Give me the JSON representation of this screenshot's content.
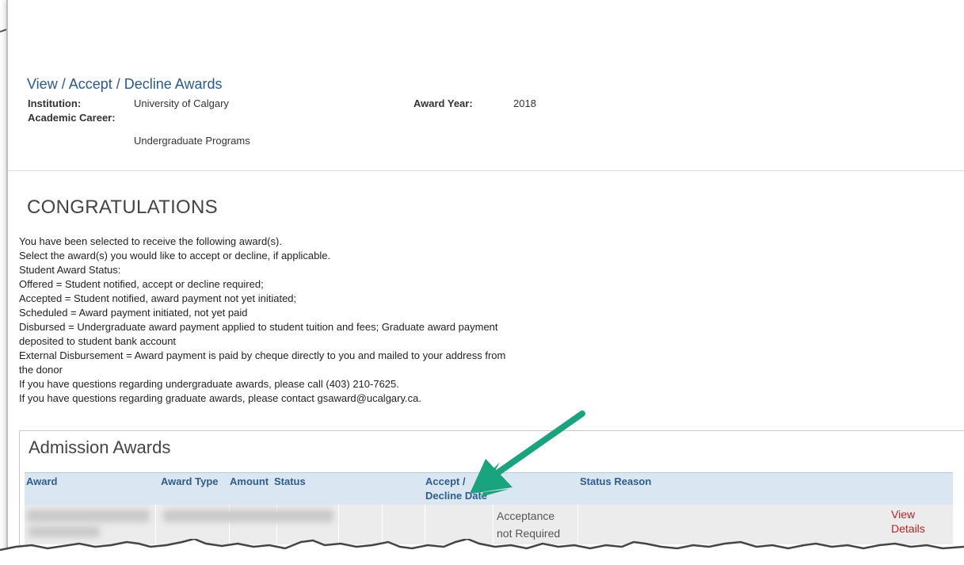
{
  "page": {
    "title": "View / Accept / Decline Awards",
    "institution_label": "Institution:",
    "institution_value": "University of Calgary",
    "award_year_label": "Award Year:",
    "award_year_value": "2018",
    "career_label": "Academic Career:",
    "career_value": "Undergraduate Programs"
  },
  "message": {
    "heading": "CONGRATULATIONS",
    "lines": [
      "You have been selected to receive the following award(s).",
      "Select the award(s) you would like to accept or decline, if applicable.",
      "Student Award Status:",
      "Offered = Student notified, accept or decline required;",
      "Accepted = Student notified, award payment not yet initiated;",
      "Scheduled = Award payment initiated, not yet paid",
      "Disbursed = Undergraduate award payment applied to student tuition and fees; Graduate award payment",
      "deposited to student bank account",
      "External Disbursement = Award payment is paid by cheque directly to you and mailed to your address from",
      "the donor",
      "If you have questions regarding undergraduate awards, please call (403) 210-7625.",
      "If you have questions regarding graduate awards, please contact gsaward@ucalgary.ca."
    ]
  },
  "awards": {
    "section_title": "Admission Awards",
    "columns": {
      "award": "Award",
      "award_type": "Award Type",
      "amount": "Amount",
      "status": "Status",
      "accept_decline_1": "Accept /",
      "accept_decline_2": "Decline Date",
      "status_reason": "Status Reason"
    },
    "row": {
      "status_reason_1": "Acceptance",
      "status_reason_2": "not Required",
      "view_details_1": "View",
      "view_details_2": "Details"
    }
  },
  "colors": {
    "title_blue": "#2b5a8a",
    "header_bg": "#dae6f2",
    "link_red": "#c21d2a",
    "arrow_green": "#1aa37f"
  }
}
